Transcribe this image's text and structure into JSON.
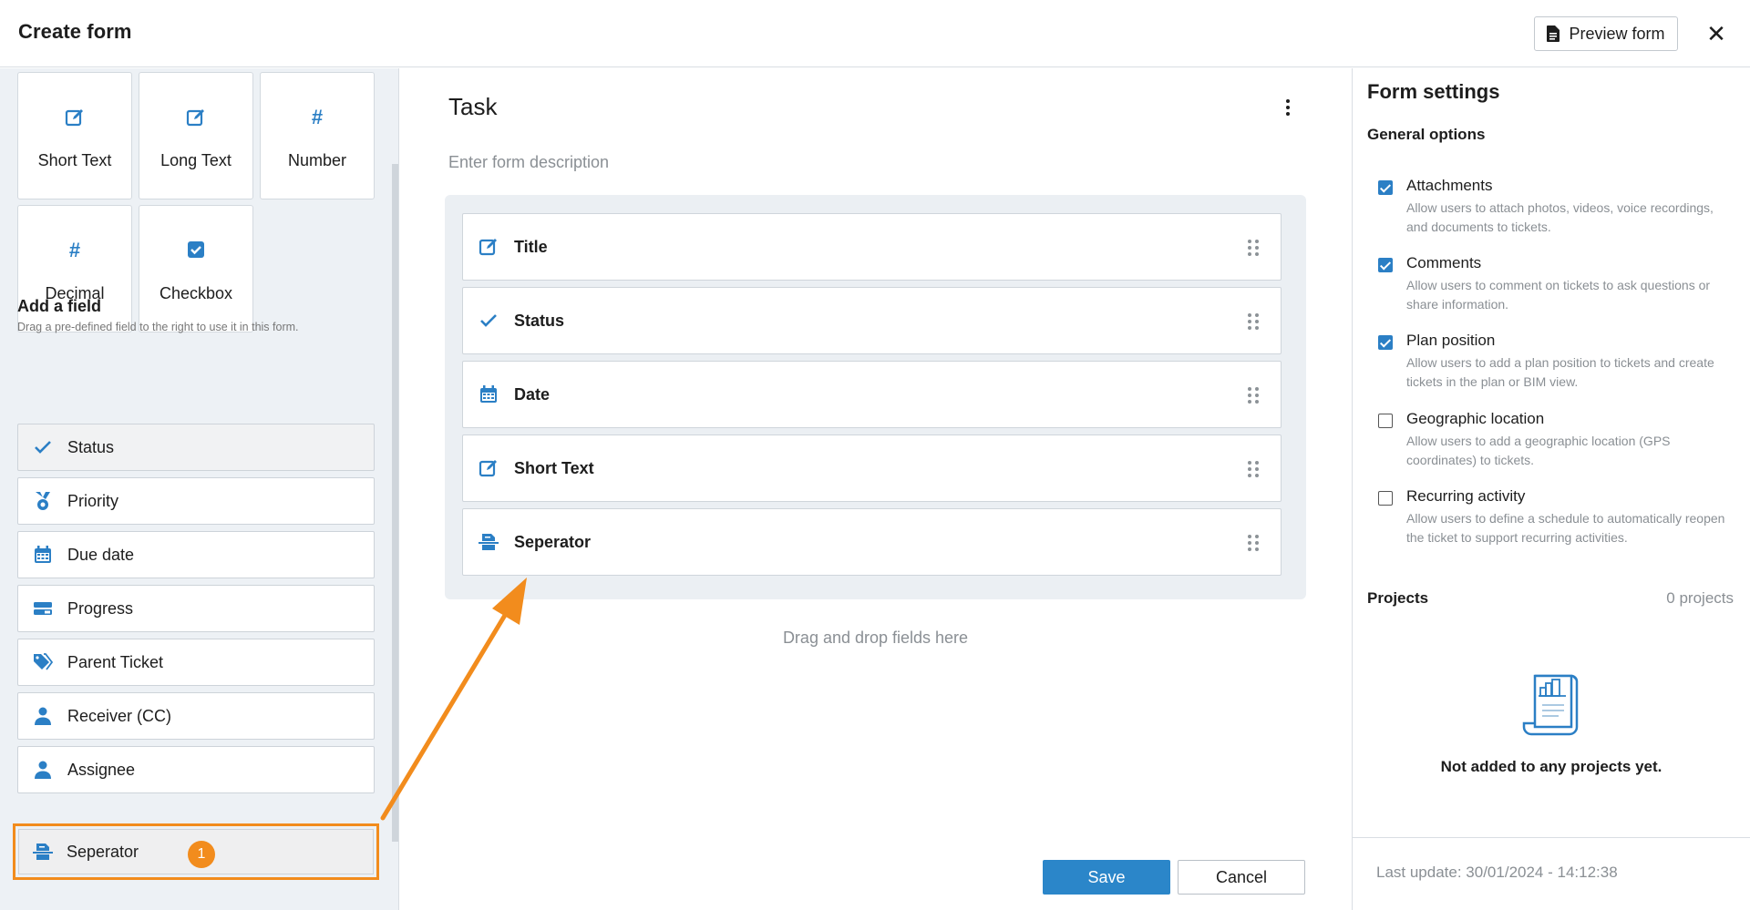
{
  "header": {
    "title": "Create form",
    "preview_label": "Preview form",
    "close_icon": "close-icon"
  },
  "field_types": [
    {
      "label": "Short Text",
      "icon": "edit-icon"
    },
    {
      "label": "Long Text",
      "icon": "edit-icon"
    },
    {
      "label": "Number",
      "icon": "hash-icon"
    },
    {
      "label": "Decimal",
      "icon": "hash-icon"
    },
    {
      "label": "Checkbox",
      "icon": "checkbox-icon"
    }
  ],
  "add_field": {
    "title": "Add a field",
    "subtitle": "Drag a pre-defined field to the right to use it in this form.",
    "items": [
      {
        "label": "Status",
        "icon": "check-icon"
      },
      {
        "label": "Priority",
        "icon": "medal-icon"
      },
      {
        "label": "Due date",
        "icon": "calendar-icon"
      },
      {
        "label": "Progress",
        "icon": "progress-icon"
      },
      {
        "label": "Parent Ticket",
        "icon": "tag-icon"
      },
      {
        "label": "Receiver (CC)",
        "icon": "user-icon"
      },
      {
        "label": "Assignee",
        "icon": "user-icon"
      }
    ],
    "highlighted": {
      "label": "Seperator",
      "icon": "separator-icon",
      "badge": "1"
    }
  },
  "form": {
    "title": "Task",
    "description_placeholder": "Enter form description",
    "fields": [
      {
        "label": "Title",
        "icon": "edit-icon"
      },
      {
        "label": "Status",
        "icon": "check-icon"
      },
      {
        "label": "Date",
        "icon": "calendar-icon"
      },
      {
        "label": "Short Text",
        "icon": "edit-icon"
      },
      {
        "label": "Seperator",
        "icon": "separator-icon"
      }
    ],
    "drop_hint": "Drag and drop fields here",
    "save_label": "Save",
    "cancel_label": "Cancel"
  },
  "settings": {
    "title": "Form settings",
    "general_title": "General options",
    "options": [
      {
        "label": "Attachments",
        "description": "Allow users to attach photos, videos, voice recordings, and documents to tickets.",
        "checked": true
      },
      {
        "label": "Comments",
        "description": "Allow users to comment on tickets to ask questions or share information.",
        "checked": true
      },
      {
        "label": "Plan position",
        "description": "Allow users to add a plan position to tickets and create tickets in the plan or BIM view.",
        "checked": true
      },
      {
        "label": "Geographic location",
        "description": "Allow users to add a geographic location (GPS coordinates) to tickets.",
        "checked": false
      },
      {
        "label": "Recurring activity",
        "description": "Allow users to define a schedule to automatically reopen the ticket to support recurring activities.",
        "checked": false
      }
    ],
    "projects_label": "Projects",
    "projects_count": "0 projects",
    "empty_text": "Not added to any projects yet.",
    "last_update": "Last update: 30/01/2024 - 14:12:38"
  },
  "colors": {
    "accent": "#2b86c9",
    "highlight": "#f28c1d",
    "panel_bg": "#edf1f5"
  }
}
